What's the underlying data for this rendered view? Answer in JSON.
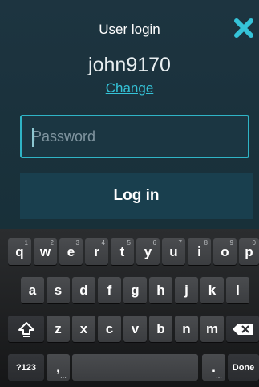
{
  "header": {
    "title": "User login",
    "close_icon": "close-icon",
    "accent_color": "#35c3d8"
  },
  "account": {
    "username": "john9170",
    "change_label": "Change"
  },
  "password": {
    "placeholder": "Password",
    "value": ""
  },
  "login_button": {
    "label": "Log in"
  },
  "keyboard": {
    "row1": [
      {
        "label": "q",
        "hint": "1"
      },
      {
        "label": "w",
        "hint": "2"
      },
      {
        "label": "e",
        "hint": "3"
      },
      {
        "label": "r",
        "hint": "4"
      },
      {
        "label": "t",
        "hint": "5"
      },
      {
        "label": "y",
        "hint": "6"
      },
      {
        "label": "u",
        "hint": "7"
      },
      {
        "label": "i",
        "hint": "8"
      },
      {
        "label": "o",
        "hint": "9"
      },
      {
        "label": "p",
        "hint": "0"
      }
    ],
    "row2": [
      "a",
      "s",
      "d",
      "f",
      "g",
      "h",
      "j",
      "k",
      "l"
    ],
    "row3": [
      "z",
      "x",
      "c",
      "v",
      "b",
      "n",
      "m"
    ],
    "symbols_label": "?123",
    "comma_label": ",",
    "period_label": ".",
    "done_label": "Done",
    "shift_icon": "shift-icon",
    "backspace_icon": "backspace-icon"
  }
}
